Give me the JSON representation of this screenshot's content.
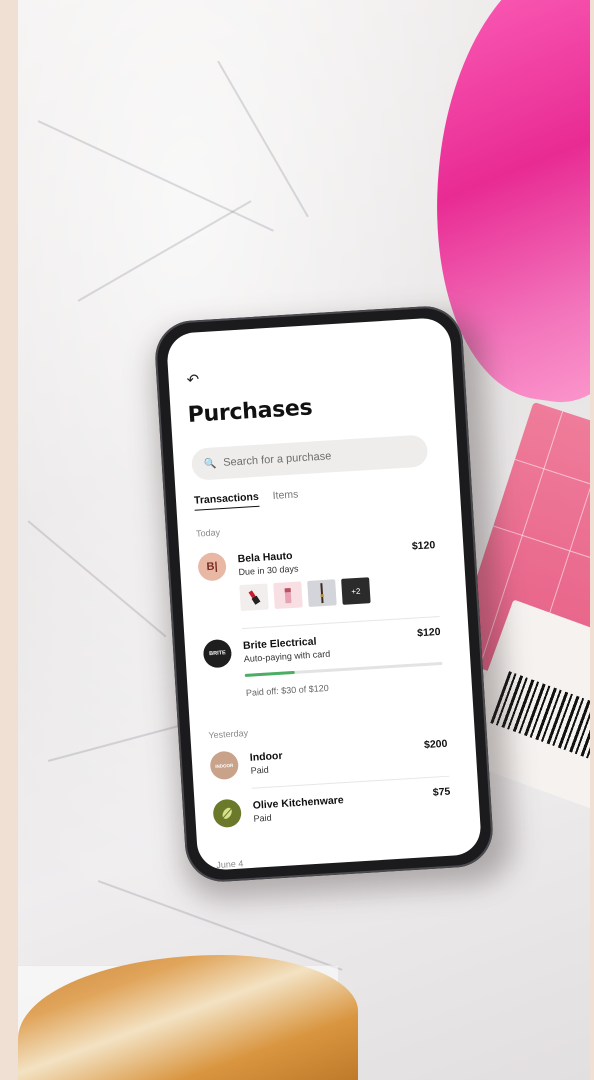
{
  "app": {
    "back_icon": "back-arrow-icon",
    "title": "Purchases",
    "search": {
      "placeholder": "Search for a purchase",
      "icon": "search-icon"
    },
    "tabs": [
      {
        "label": "Transactions",
        "active": true
      },
      {
        "label": "Items",
        "active": false
      }
    ],
    "sections": {
      "today": "Today",
      "yesterday": "Yesterday",
      "june4": "June 4"
    },
    "transactions": [
      {
        "merchant": "Bela Hauto",
        "status": "Due in 30 days",
        "amount": "$120",
        "avatar_color": "#e8b8a4",
        "thumbs_more": "+2"
      },
      {
        "merchant": "Brite Electrical",
        "status": "Auto-paying with card",
        "amount": "$120",
        "avatar_color": "#1e1e1e",
        "avatar_text": "BRITE",
        "paid_off": "Paid off: $30 of $120",
        "progress": 0.25
      },
      {
        "merchant": "Indoor",
        "status": "Paid",
        "amount": "$200",
        "avatar_color": "#c9a28a",
        "avatar_text": "INDOOR"
      },
      {
        "merchant": "Olive Kitchenware",
        "status": "Paid",
        "amount": "$75",
        "avatar_color": "#6b7a2a"
      }
    ],
    "colors": {
      "progress_fill": "#4cae64",
      "accent_pink": "#e8218f"
    }
  }
}
